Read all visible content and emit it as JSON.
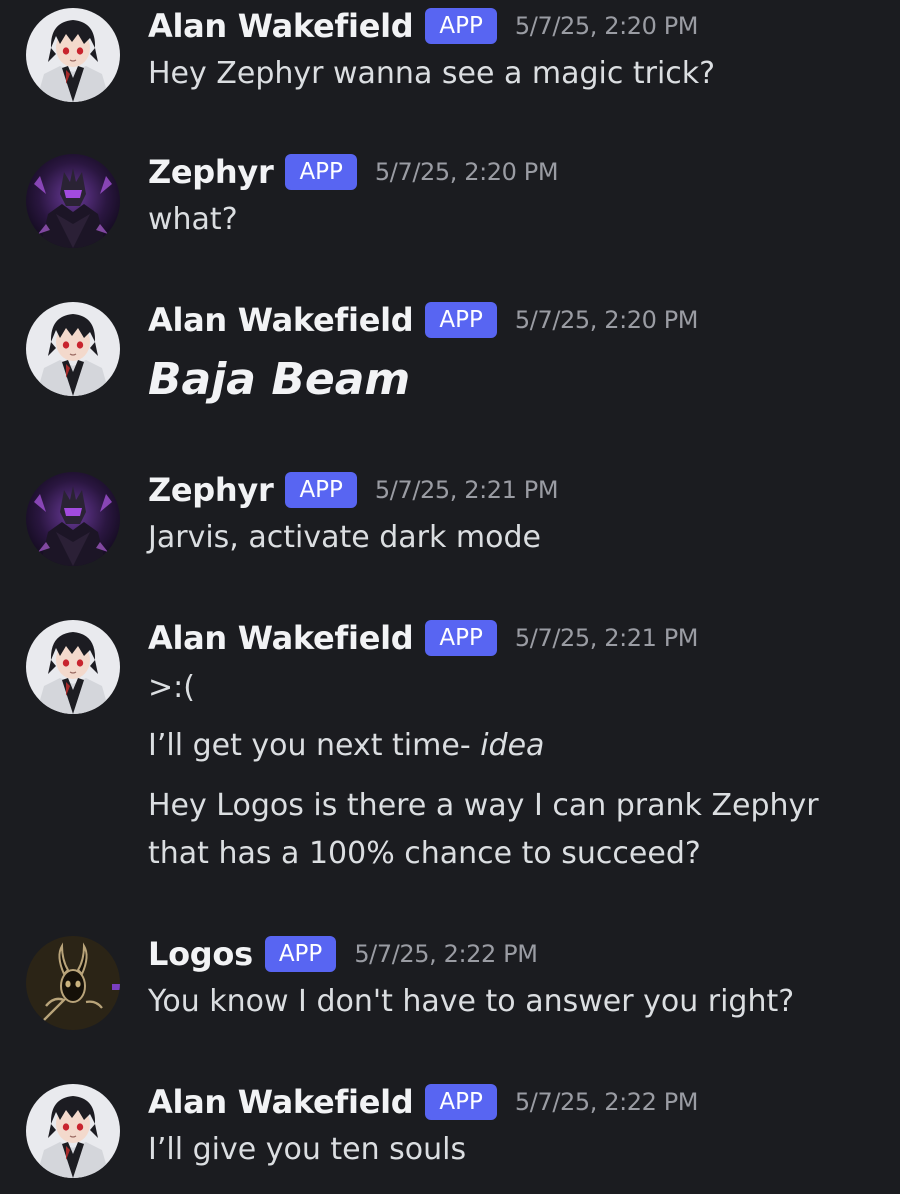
{
  "app": {
    "accent": "#5865f2",
    "background": "#1b1c20"
  },
  "messages": [
    {
      "author": "Alan Wakefield",
      "badge": "APP",
      "time": "5/7/25, 2:20 PM",
      "avatar": "alan-avatar",
      "lines": [
        "Hey Zephyr wanna see a magic trick?"
      ]
    },
    {
      "author": "Zephyr",
      "badge": "APP",
      "time": "5/7/25, 2:20 PM",
      "avatar": "zephyr-avatar",
      "lines": [
        "what?"
      ]
    },
    {
      "author": "Alan Wakefield",
      "badge": "APP",
      "time": "5/7/25, 2:20 PM",
      "avatar": "alan-avatar",
      "lines": [
        "Baja Beam"
      ]
    },
    {
      "author": "Zephyr",
      "badge": "APP",
      "time": "5/7/25, 2:21 PM",
      "avatar": "zephyr-avatar",
      "lines": [
        "Jarvis, activate dark mode"
      ]
    },
    {
      "author": "Alan Wakefield",
      "badge": "APP",
      "time": "5/7/25, 2:21 PM",
      "avatar": "alan-avatar",
      "lines": [
        ">:(",
        "I’ll get you next time- ",
        "idea",
        "Hey Logos is there a way I can prank Zephyr that has a 100% chance to succeed?"
      ]
    },
    {
      "author": "Logos",
      "badge": "APP",
      "time": "5/7/25, 2:22 PM",
      "avatar": "logos-avatar",
      "lines": [
        "You know I don't have to answer you right?"
      ]
    },
    {
      "author": "Alan Wakefield",
      "badge": "APP",
      "time": "5/7/25, 2:22 PM",
      "avatar": "alan-avatar",
      "lines": [
        "I’ll give you ten souls"
      ]
    }
  ]
}
